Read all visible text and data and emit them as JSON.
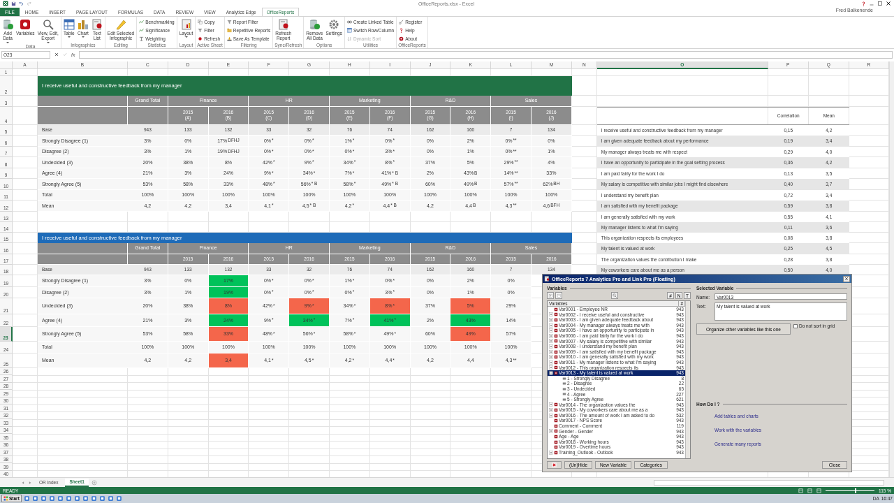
{
  "window": {
    "title": "OfficeReports.xlsx - Excel",
    "user": "Fred Balkenende"
  },
  "ribbon": {
    "tabs": [
      {
        "label": "FILE",
        "kind": "file",
        "selected": false
      },
      {
        "label": "HOME",
        "kind": "tab",
        "selected": false
      },
      {
        "label": "INSERT",
        "kind": "tab",
        "selected": false
      },
      {
        "label": "PAGE LAYOUT",
        "kind": "tab",
        "selected": false
      },
      {
        "label": "FORMULAS",
        "kind": "tab",
        "selected": false
      },
      {
        "label": "DATA",
        "kind": "tab",
        "selected": false
      },
      {
        "label": "REVIEW",
        "kind": "tab",
        "selected": false
      },
      {
        "label": "VIEW",
        "kind": "tab",
        "selected": false
      },
      {
        "label": "Analytics Edge",
        "kind": "tab",
        "selected": false
      },
      {
        "label": "OfficeReports",
        "kind": "tab",
        "selected": true
      }
    ],
    "groups": [
      {
        "name": "Data",
        "buttons": [
          {
            "kind": "large",
            "label": "Add\nData",
            "dropdown": true
          },
          {
            "kind": "large",
            "label": "Variables",
            "dropdown": false
          },
          {
            "kind": "large",
            "label": "View, Edit,\nExport",
            "dropdown": true
          }
        ]
      },
      {
        "name": "Infographics",
        "buttons": [
          {
            "kind": "large",
            "label": "Table",
            "dropdown": true
          },
          {
            "kind": "large",
            "label": "Chart",
            "dropdown": true
          },
          {
            "kind": "large",
            "label": "Text\nList",
            "dropdown": false
          }
        ]
      },
      {
        "name": "Editing",
        "buttons": [
          {
            "kind": "large",
            "label": "Edit Selected\nInfographic",
            "dropdown": false
          }
        ]
      },
      {
        "name": "Statistics",
        "buttons": [
          {
            "kind": "small",
            "label": "Benchmarking",
            "disabled": false
          },
          {
            "kind": "small",
            "label": "Significance",
            "disabled": false
          },
          {
            "kind": "small",
            "label": "Weighting",
            "disabled": false
          }
        ]
      },
      {
        "name": "Layout",
        "buttons": [
          {
            "kind": "large",
            "label": "Layout",
            "dropdown": true
          }
        ]
      },
      {
        "name": "Active Sheet",
        "buttons": [
          {
            "kind": "small",
            "label": "Copy",
            "disabled": false
          },
          {
            "kind": "small",
            "label": "Filter",
            "disabled": false
          },
          {
            "kind": "small",
            "label": "Refresh",
            "disabled": false
          }
        ]
      },
      {
        "name": "Filtering",
        "buttons": [
          {
            "kind": "small",
            "label": "Report Filter",
            "disabled": false
          },
          {
            "kind": "small",
            "label": "Repetitive Reports",
            "disabled": false
          },
          {
            "kind": "small",
            "label": "Save As Template",
            "disabled": false
          }
        ]
      },
      {
        "name": "Sync/Refresh",
        "buttons": [
          {
            "kind": "large",
            "label": "Refresh\nReport",
            "dropdown": false
          }
        ]
      },
      {
        "name": "Options",
        "buttons": [
          {
            "kind": "large",
            "label": "Remove\nAll Data",
            "dropdown": false
          },
          {
            "kind": "large",
            "label": "Settings",
            "dropdown": false
          }
        ]
      },
      {
        "name": "Utilities",
        "buttons": [
          {
            "kind": "small",
            "label": "Create Linked Table",
            "disabled": false
          },
          {
            "kind": "small",
            "label": "Switch Row/Column",
            "disabled": false
          },
          {
            "kind": "small",
            "label": "Dynamic Sort",
            "disabled": true
          }
        ]
      },
      {
        "name": "OfficeReports",
        "buttons": [
          {
            "kind": "small",
            "label": "Register",
            "disabled": false
          },
          {
            "kind": "small",
            "label": "Help",
            "disabled": false
          },
          {
            "kind": "small",
            "label": "About",
            "disabled": false
          }
        ]
      }
    ]
  },
  "formula_bar": {
    "name_box": "O23",
    "function_label": "fx"
  },
  "columns": [
    {
      "label": "A",
      "selected": false
    },
    {
      "label": "B",
      "selected": false
    },
    {
      "label": "C",
      "selected": false
    },
    {
      "label": "D",
      "selected": false
    },
    {
      "label": "E",
      "selected": false
    },
    {
      "label": "F",
      "selected": false
    },
    {
      "label": "G",
      "selected": false
    },
    {
      "label": "H",
      "selected": false
    },
    {
      "label": "I",
      "selected": false
    },
    {
      "label": "J",
      "selected": false
    },
    {
      "label": "K",
      "selected": false
    },
    {
      "label": "L",
      "selected": false
    },
    {
      "label": "M",
      "selected": false
    },
    {
      "label": "N",
      "selected": false
    },
    {
      "label": "O",
      "selected": true
    },
    {
      "label": "P",
      "selected": false
    },
    {
      "label": "Q",
      "selected": false
    },
    {
      "label": "R",
      "selected": false
    }
  ],
  "rows": [
    {
      "label": "1",
      "selected": false
    },
    {
      "label": "2",
      "selected": false
    },
    {
      "label": "3",
      "selected": false
    },
    {
      "label": "4",
      "selected": false
    },
    {
      "label": "5",
      "selected": false
    },
    {
      "label": "6",
      "selected": false
    },
    {
      "label": "7",
      "selected": false
    },
    {
      "label": "8",
      "selected": false
    },
    {
      "label": "9",
      "selected": false
    },
    {
      "label": "10",
      "selected": false
    },
    {
      "label": "11",
      "selected": false
    },
    {
      "label": "12",
      "selected": false
    },
    {
      "label": "13",
      "selected": false
    },
    {
      "label": "14",
      "selected": false
    },
    {
      "label": "15",
      "selected": false
    },
    {
      "label": "16",
      "selected": false
    },
    {
      "label": "17",
      "selected": false
    },
    {
      "label": "18",
      "selected": false
    },
    {
      "label": "19",
      "selected": false
    },
    {
      "label": "20",
      "selected": false
    },
    {
      "label": "21",
      "selected": false
    },
    {
      "label": "22",
      "selected": false
    },
    {
      "label": "23",
      "selected": true
    },
    {
      "label": "24",
      "selected": false
    },
    {
      "label": "25",
      "selected": false
    },
    {
      "label": "26",
      "selected": false
    },
    {
      "label": "27",
      "selected": false
    },
    {
      "label": "28",
      "selected": false
    },
    {
      "label": "29",
      "selected": false
    },
    {
      "label": "30",
      "selected": false
    },
    {
      "label": "31",
      "selected": false
    },
    {
      "label": "32",
      "selected": false
    },
    {
      "label": "33",
      "selected": false
    },
    {
      "label": "34",
      "selected": false
    },
    {
      "label": "35",
      "selected": false
    },
    {
      "label": "36",
      "selected": false
    },
    {
      "label": "37",
      "selected": false
    },
    {
      "label": "38",
      "selected": false
    },
    {
      "label": "39",
      "selected": false
    },
    {
      "label": "40",
      "selected": false
    }
  ],
  "tables": [
    {
      "title": "I receive useful and constructive feedback from my manager",
      "color": "#217346",
      "grand_total": "Grand Total",
      "groups": [
        {
          "name": "Finance",
          "years": [
            {
              "label": "2015",
              "letter": "(A)"
            },
            {
              "label": "2016",
              "letter": "(B)"
            }
          ]
        },
        {
          "name": "HR",
          "years": [
            {
              "label": "2015",
              "letter": "(C)"
            },
            {
              "label": "2016",
              "letter": "(D)"
            }
          ]
        },
        {
          "name": "Marketing",
          "years": [
            {
              "label": "2015",
              "letter": "(E)"
            },
            {
              "label": "2016",
              "letter": "(F)"
            }
          ]
        },
        {
          "name": "R&D",
          "years": [
            {
              "label": "2015",
              "letter": "(G)"
            },
            {
              "label": "2016",
              "letter": "(H)"
            }
          ]
        },
        {
          "name": "Sales",
          "years": [
            {
              "label": "2015",
              "letter": "(I)"
            },
            {
              "label": "2016",
              "letter": "(J)"
            }
          ]
        }
      ],
      "rows": [
        {
          "label": "Base",
          "kind": "base",
          "cells": [
            {
              "value": "943"
            },
            {
              "value": "133"
            },
            {
              "value": "132"
            },
            {
              "value": "33"
            },
            {
              "value": "32"
            },
            {
              "value": "76"
            },
            {
              "value": "74"
            },
            {
              "value": "162"
            },
            {
              "value": "160"
            },
            {
              "value": "7"
            },
            {
              "value": "134"
            }
          ]
        },
        {
          "label": "Strongly Disagree (1)",
          "kind": "data",
          "cells": [
            {
              "value": "3%"
            },
            {
              "value": "0%"
            },
            {
              "value": "17%",
              "sig": "DFHJ"
            },
            {
              "value": "0%",
              "sig": "*"
            },
            {
              "value": "0%",
              "sig": "*"
            },
            {
              "value": "1%",
              "sig": "*"
            },
            {
              "value": "0%",
              "sig": "*"
            },
            {
              "value": "0%"
            },
            {
              "value": "2%"
            },
            {
              "value": "0%",
              "sig": "**"
            },
            {
              "value": "0%"
            }
          ]
        },
        {
          "label": "Disagree (2)",
          "kind": "data",
          "cells": [
            {
              "value": "3%"
            },
            {
              "value": "1%"
            },
            {
              "value": "19%",
              "sig": "DFHJ"
            },
            {
              "value": "0%",
              "sig": "*"
            },
            {
              "value": "0%",
              "sig": "*"
            },
            {
              "value": "0%",
              "sig": "*"
            },
            {
              "value": "3%",
              "sig": "*"
            },
            {
              "value": "0%"
            },
            {
              "value": "1%"
            },
            {
              "value": "0%",
              "sig": "**"
            },
            {
              "value": "1%"
            }
          ]
        },
        {
          "label": "Undecided (3)",
          "kind": "data",
          "cells": [
            {
              "value": "20%"
            },
            {
              "value": "38%"
            },
            {
              "value": "8%"
            },
            {
              "value": "42%",
              "sig": "*"
            },
            {
              "value": "9%",
              "sig": "*"
            },
            {
              "value": "34%",
              "sig": "*"
            },
            {
              "value": "8%",
              "sig": "*"
            },
            {
              "value": "37%"
            },
            {
              "value": "5%"
            },
            {
              "value": "29%",
              "sig": "**"
            },
            {
              "value": "4%"
            }
          ]
        },
        {
          "label": "Agree (4)",
          "kind": "data",
          "cells": [
            {
              "value": "21%"
            },
            {
              "value": "3%"
            },
            {
              "value": "24%"
            },
            {
              "value": "9%",
              "sig": "*"
            },
            {
              "value": "34%",
              "sig": "*"
            },
            {
              "value": "7%",
              "sig": "*"
            },
            {
              "value": "41%",
              "sig": "* B"
            },
            {
              "value": "2%"
            },
            {
              "value": "43%",
              "sig": "B"
            },
            {
              "value": "14%",
              "sig": "**"
            },
            {
              "value": "33%"
            }
          ]
        },
        {
          "label": "Strongly Agree (5)",
          "kind": "data",
          "cells": [
            {
              "value": "53%"
            },
            {
              "value": "58%"
            },
            {
              "value": "33%"
            },
            {
              "value": "48%",
              "sig": "*"
            },
            {
              "value": "56%",
              "sig": "* B"
            },
            {
              "value": "58%",
              "sig": "*"
            },
            {
              "value": "49%",
              "sig": "* B"
            },
            {
              "value": "60%"
            },
            {
              "value": "49%",
              "sig": "B"
            },
            {
              "value": "57%",
              "sig": "**"
            },
            {
              "value": "62%",
              "sig": "BH"
            }
          ]
        },
        {
          "label": "Total",
          "kind": "data",
          "cells": [
            {
              "value": "100%"
            },
            {
              "value": "100%"
            },
            {
              "value": "100%"
            },
            {
              "value": "100%"
            },
            {
              "value": "100%"
            },
            {
              "value": "100%"
            },
            {
              "value": "100%"
            },
            {
              "value": "100%"
            },
            {
              "value": "100%"
            },
            {
              "value": "100%"
            },
            {
              "value": "100%"
            }
          ]
        },
        {
          "label": "Mean",
          "kind": "data",
          "cells": [
            {
              "value": "4,2"
            },
            {
              "value": "4,2"
            },
            {
              "value": "3,4"
            },
            {
              "value": "4,1",
              "sig": "*"
            },
            {
              "value": "4,5",
              "sig": "* B"
            },
            {
              "value": "4,2",
              "sig": "*"
            },
            {
              "value": "4,4",
              "sig": "* B"
            },
            {
              "value": "4,2"
            },
            {
              "value": "4,4",
              "sig": "B"
            },
            {
              "value": "4,3",
              "sig": "**"
            },
            {
              "value": "4,6",
              "sig": "BFH"
            }
          ]
        }
      ]
    },
    {
      "title": "I receive useful and constructive feedback from my manager",
      "color": "#1e6bb8",
      "grand_total": "Grand Total",
      "groups": [
        {
          "name": "Finance",
          "years": [
            {
              "label": "2015"
            },
            {
              "label": "2016"
            }
          ]
        },
        {
          "name": "HR",
          "years": [
            {
              "label": "2015"
            },
            {
              "label": "2016"
            }
          ]
        },
        {
          "name": "Marketing",
          "years": [
            {
              "label": "2015"
            },
            {
              "label": "2016"
            }
          ]
        },
        {
          "name": "R&D",
          "years": [
            {
              "label": "2015"
            },
            {
              "label": "2016"
            }
          ]
        },
        {
          "name": "Sales",
          "years": [
            {
              "label": "2015"
            },
            {
              "label": "2016"
            }
          ]
        }
      ],
      "rows": [
        {
          "label": "Base",
          "kind": "base",
          "cells": [
            {
              "value": "943"
            },
            {
              "value": "133"
            },
            {
              "value": "132"
            },
            {
              "value": "33"
            },
            {
              "value": "32"
            },
            {
              "value": "76"
            },
            {
              "value": "74"
            },
            {
              "value": "162"
            },
            {
              "value": "160"
            },
            {
              "value": "7"
            },
            {
              "value": "134"
            }
          ]
        },
        {
          "label": "Strongly Disagree (1)",
          "kind": "data",
          "cells": [
            {
              "value": "3%"
            },
            {
              "value": "0%"
            },
            {
              "value": "17%",
              "color": "#00c25a"
            },
            {
              "value": "0%",
              "sig": "*"
            },
            {
              "value": "0%",
              "sig": "*"
            },
            {
              "value": "1%",
              "sig": "*"
            },
            {
              "value": "0%",
              "sig": "*"
            },
            {
              "value": "0%"
            },
            {
              "value": "2%"
            },
            {
              "value": "0%"
            }
          ]
        },
        {
          "label": "Disagree (2)",
          "kind": "data",
          "cells": [
            {
              "value": "3%"
            },
            {
              "value": "1%"
            },
            {
              "value": "19%",
              "color": "#00c25a"
            },
            {
              "value": "0%",
              "sig": "*"
            },
            {
              "value": "0%",
              "sig": "*"
            },
            {
              "value": "0%",
              "sig": "*"
            },
            {
              "value": "3%",
              "sig": "*"
            },
            {
              "value": "0%"
            },
            {
              "value": "1%"
            },
            {
              "value": "0%"
            }
          ]
        },
        {
          "label": "Undecided (3)",
          "kind": "data",
          "cells": [
            {
              "value": "20%"
            },
            {
              "value": "38%"
            },
            {
              "value": "8%",
              "color": "#f4664b"
            },
            {
              "value": "42%",
              "sig": "*"
            },
            {
              "value": "9%",
              "sig": "*",
              "color": "#f4664b"
            },
            {
              "value": "34%",
              "sig": "*"
            },
            {
              "value": "8%",
              "sig": "*",
              "color": "#f4664b"
            },
            {
              "value": "37%"
            },
            {
              "value": "5%",
              "color": "#f4664b"
            },
            {
              "value": "29%"
            }
          ]
        },
        {
          "label": "Agree (4)",
          "kind": "data",
          "cells": [
            {
              "value": "21%"
            },
            {
              "value": "3%"
            },
            {
              "value": "24%",
              "color": "#00c25a"
            },
            {
              "value": "9%",
              "sig": "*"
            },
            {
              "value": "34%",
              "sig": "*",
              "color": "#00c25a"
            },
            {
              "value": "7%",
              "sig": "*"
            },
            {
              "value": "41%",
              "sig": "*",
              "color": "#00c25a"
            },
            {
              "value": "2%"
            },
            {
              "value": "43%",
              "color": "#00c25a"
            },
            {
              "value": "14%"
            }
          ]
        },
        {
          "label": "Strongly Agree (5)",
          "kind": "data",
          "cells": [
            {
              "value": "53%"
            },
            {
              "value": "58%"
            },
            {
              "value": "33%",
              "color": "#f4664b"
            },
            {
              "value": "48%",
              "sig": "*"
            },
            {
              "value": "56%",
              "sig": "*"
            },
            {
              "value": "58%",
              "sig": "*"
            },
            {
              "value": "49%",
              "sig": "*"
            },
            {
              "value": "60%"
            },
            {
              "value": "49%",
              "color": "#f4664b"
            },
            {
              "value": "57%"
            }
          ]
        },
        {
          "label": "Total",
          "kind": "data",
          "cells": [
            {
              "value": "100%"
            },
            {
              "value": "100%"
            },
            {
              "value": "100%"
            },
            {
              "value": "100%"
            },
            {
              "value": "100%"
            },
            {
              "value": "100%"
            },
            {
              "value": "100%"
            },
            {
              "value": "100%"
            },
            {
              "value": "100%"
            },
            {
              "value": "100%"
            }
          ]
        },
        {
          "label": "Mean",
          "kind": "data",
          "cells": [
            {
              "value": "4,2"
            },
            {
              "value": "4,2"
            },
            {
              "value": "3,4",
              "color": "#f4664b"
            },
            {
              "value": "4,1",
              "sig": "*"
            },
            {
              "value": "4,5",
              "sig": "*"
            },
            {
              "value": "4,2",
              "sig": "*"
            },
            {
              "value": "4,4",
              "sig": "*"
            },
            {
              "value": "4,2"
            },
            {
              "value": "4,4"
            },
            {
              "value": "4,3",
              "sig": "**"
            }
          ]
        }
      ]
    }
  ],
  "correlation": {
    "columns": [
      "Correlation",
      "Mean"
    ],
    "rows": [
      {
        "label": "I receive useful and constructive feedback from my manager",
        "correlation": "0,15",
        "mean": "4,2"
      },
      {
        "label": "I am given adequate feedback about my performance",
        "correlation": "0,19",
        "mean": "3,4"
      },
      {
        "label": "My manager always treats me with respect",
        "correlation": "0,29",
        "mean": "4,0"
      },
      {
        "label": "I have an opportunity to participate in the goal setting process",
        "correlation": "0,36",
        "mean": "4,2"
      },
      {
        "label": "I am paid fairly for the work I do",
        "correlation": "0,13",
        "mean": "3,5"
      },
      {
        "label": "My salary is competitive with similar jobs I might find elsewhere",
        "correlation": "0,40",
        "mean": "3,7"
      },
      {
        "label": "I understand my benefit plan",
        "correlation": "0,72",
        "mean": "3,4"
      },
      {
        "label": "I am satisfied with my benefit package",
        "correlation": "0,59",
        "mean": "3,8"
      },
      {
        "label": "I am generally satisfied with my work",
        "correlation": "0,55",
        "mean": "4,1"
      },
      {
        "label": "My manager listens to what I'm saying",
        "correlation": "0,11",
        "mean": "3,6"
      },
      {
        "label": "This organization respects its employees",
        "correlation": "0,08",
        "mean": "3,8"
      },
      {
        "label": "My talent is valued at work",
        "correlation": "0,25",
        "mean": "4,5"
      },
      {
        "label": "The organization values the contribution I make",
        "correlation": "0,28",
        "mean": "3,8"
      },
      {
        "label": "My coworkers care about me as a person",
        "correlation": "0,50",
        "mean": "4,0"
      }
    ]
  },
  "dialog": {
    "title": "OfficeReports 7 Analytics Pro and Link Pro (Floating)",
    "variables": {
      "section": "Variables",
      "toggles": [
        "#",
        "N",
        "T"
      ],
      "list_header": "Variables",
      "count_header": "#",
      "items": [
        {
          "name": "Var0001 - Employee NR",
          "count": "943",
          "selected": false
        },
        {
          "name": "Var0002 - I receive useful and constructive",
          "count": "943",
          "expanded": false,
          "selected": false
        },
        {
          "name": "Var0003 - I am given adequate feedback about",
          "count": "943",
          "expanded": false,
          "selected": false
        },
        {
          "name": "Var0004 - My manager always treats me with",
          "count": "943",
          "expanded": false,
          "selected": false
        },
        {
          "name": "Var0005 - I have an opportunity to participate in",
          "count": "943",
          "expanded": false,
          "selected": false
        },
        {
          "name": "Var0006 - I am paid fairly for the work I do",
          "count": "943",
          "expanded": false,
          "selected": false
        },
        {
          "name": "Var0007 - My salary is competitive with similar",
          "count": "943",
          "expanded": false,
          "selected": false
        },
        {
          "name": "Var0008 - I understand my benefit plan",
          "count": "943",
          "expanded": false,
          "selected": false
        },
        {
          "name": "Var0009 - I am satisfied with my benefit package",
          "count": "943",
          "expanded": false,
          "selected": false
        },
        {
          "name": "Var0010 - I am generally satisfied with my work",
          "count": "943",
          "expanded": false,
          "selected": false
        },
        {
          "name": "Var0011 - My manager listens to what I'm saying",
          "count": "943",
          "expanded": false,
          "selected": false
        },
        {
          "name": "Var0012 - This organization respects its",
          "count": "943",
          "expanded": false,
          "selected": false
        },
        {
          "name": "Var0013 - My talent is valued at work",
          "count": "943",
          "expanded": true,
          "selected": true,
          "children": [
            {
              "name": "1 - Strongly Disagree",
              "count": "8",
              "selected": false
            },
            {
              "name": "2 - Disagree",
              "count": "22",
              "selected": false
            },
            {
              "name": "3 - Undecided",
              "count": "65",
              "selected": false
            },
            {
              "name": "4 - Agree",
              "count": "227",
              "selected": false
            },
            {
              "name": "5 - Strongly Agree",
              "count": "621",
              "selected": false
            }
          ]
        },
        {
          "name": "Var0014 - The organization values the",
          "count": "943",
          "expanded": false,
          "selected": false
        },
        {
          "name": "Var0015 - My coworkers care about me as a",
          "count": "943",
          "expanded": false,
          "selected": false
        },
        {
          "name": "Var0016 - The amount of work I am asked to do",
          "count": "532",
          "expanded": false,
          "selected": false
        },
        {
          "name": "Var0017 - NPS Score",
          "count": "943",
          "selected": false
        },
        {
          "name": "Comment - Comment",
          "count": "119",
          "selected": false
        },
        {
          "name": "Gender - Gender",
          "count": "943",
          "expanded": false,
          "selected": false
        },
        {
          "name": "Age - Age",
          "count": "943",
          "selected": false
        },
        {
          "name": "Var0018 - Working hours",
          "count": "943",
          "selected": false
        },
        {
          "name": "Var0019 - Overtime hours",
          "count": "943",
          "selected": false
        },
        {
          "name": "Training_Outlook - Outlook",
          "count": "943",
          "expanded": false,
          "selected": false
        }
      ]
    },
    "selected_variable": {
      "section": "Selected Variable",
      "name_label": "Name:",
      "name": "Var0013",
      "text_label": "Text:",
      "text": "My talent is valued at work",
      "organize_button": "Organize other variables like this one",
      "sort_checkbox": {
        "label": "Do not sort in grid",
        "checked": false
      }
    },
    "how_do_i": {
      "section": "How Do I ?",
      "links": [
        "Add tables and charts",
        "Work with the variables",
        "Generate many reports"
      ]
    },
    "buttons": [
      "(Un)Hide",
      "New Variable",
      "Categories"
    ],
    "close_button": "Close"
  },
  "sheet_tabs": [
    {
      "label": "OR Index",
      "selected": false
    },
    {
      "label": "Sheet1",
      "selected": true
    }
  ],
  "status_bar": {
    "status": "READY",
    "zoom": {
      "level": 0.6,
      "reading": "115 %"
    }
  },
  "taskbar": {
    "start": "Start",
    "language": "DA",
    "time": "16:47"
  }
}
